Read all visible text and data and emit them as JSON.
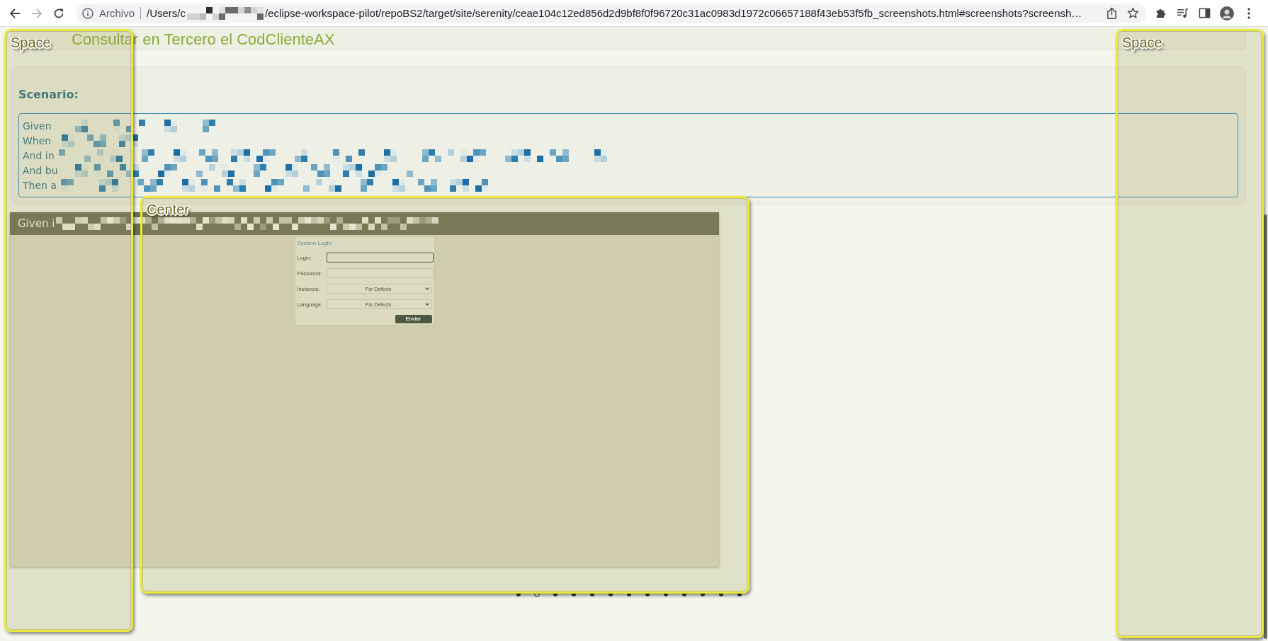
{
  "browser": {
    "nav": [
      {
        "kind": "back",
        "disabled": false
      },
      {
        "kind": "forward",
        "disabled": true
      },
      {
        "kind": "reload",
        "disabled": false
      }
    ],
    "address_label": "Archivo",
    "url_start": "/Users/c",
    "url_rest": "/eclipse-workspace-pilot/repoBS2/target/site/serenity/ceae104c12ed856d2d9bf8f0f96720c31ac0983d1972c06657188f43eb53f5fb_screenshots.html#screenshots?screensh…"
  },
  "page_title": "Consultar en Tercero el CodClienteAX",
  "scenario": {
    "heading": "Scenario:",
    "steps": [
      {
        "text": "Given"
      },
      {
        "text": "When"
      },
      {
        "text": "And in"
      },
      {
        "text": "And bu"
      },
      {
        "text": "Then a"
      }
    ]
  },
  "screenshot": {
    "caption": "Given i",
    "login": {
      "title": "System Login",
      "fields": [
        {
          "kind": "input",
          "label": "Login:",
          "focused": true
        },
        {
          "kind": "input",
          "label": "Password:",
          "focused": false
        },
        {
          "kind": "select",
          "label": "Instancia:",
          "value": "Por Defecto.",
          "focused": false
        },
        {
          "kind": "select",
          "label": "Language:",
          "value": "Por Defecto.",
          "focused": false
        }
      ],
      "submit": "Enviar"
    }
  },
  "carousel": {
    "dots": [
      {
        "selected": false
      },
      {
        "selected": true
      },
      {
        "selected": false
      },
      {
        "selected": false
      },
      {
        "selected": false
      },
      {
        "selected": false
      },
      {
        "selected": false
      },
      {
        "selected": false
      },
      {
        "selected": false
      },
      {
        "selected": false
      },
      {
        "selected": false
      },
      {
        "selected": false
      },
      {
        "selected": false
      }
    ]
  },
  "annotations": [
    {
      "label": "Space"
    },
    {
      "label": "Center"
    },
    {
      "label": "Space"
    }
  ]
}
